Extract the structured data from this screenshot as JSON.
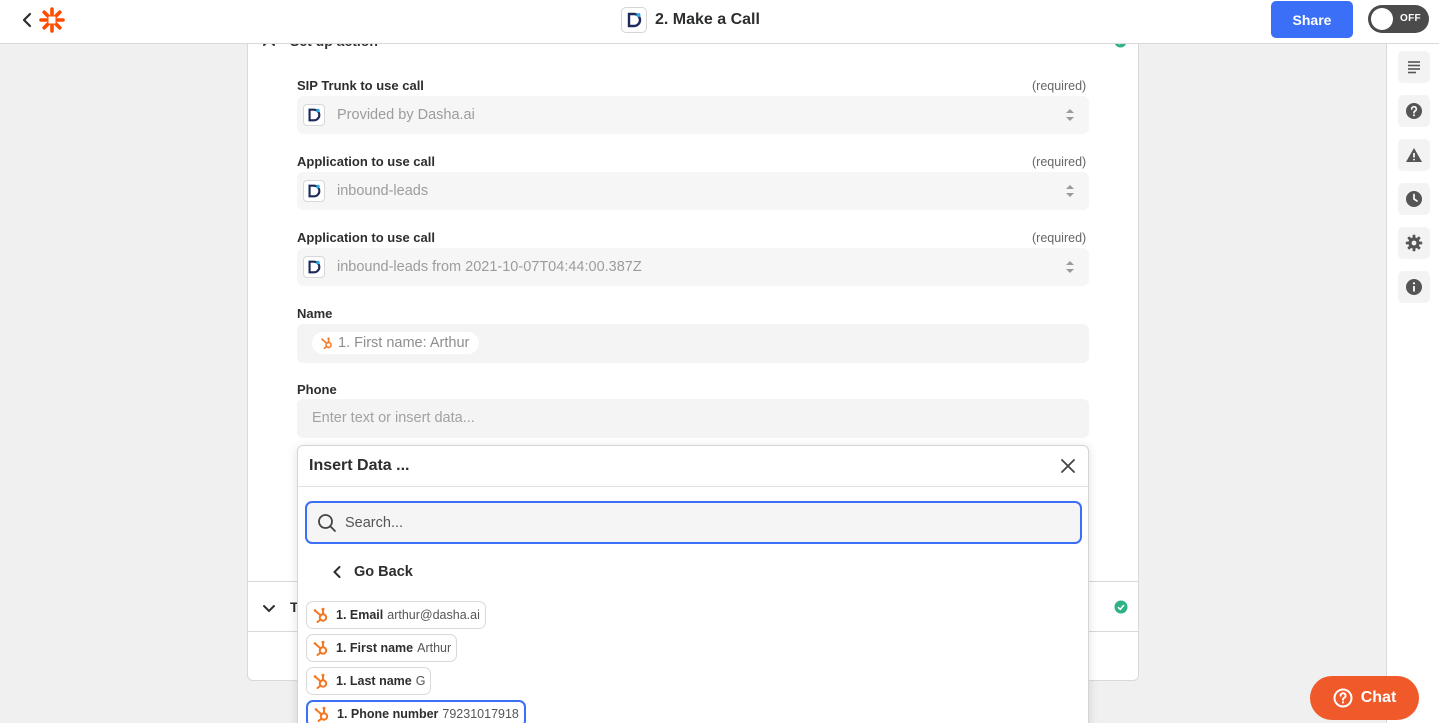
{
  "header": {
    "title": "2. Make a Call",
    "share_label": "Share",
    "toggle_label": "OFF"
  },
  "section": {
    "title": "Set up action",
    "collapsed_letter": "T"
  },
  "fields": [
    {
      "label": "SIP Trunk to use call",
      "required": "(required)",
      "value": "Provided by Dasha.ai"
    },
    {
      "label": "Application to use call",
      "required": "(required)",
      "value": "inbound-leads"
    },
    {
      "label": "Application to use call",
      "required": "(required)",
      "value": "inbound-leads from 2021-10-07T04:44:00.387Z"
    }
  ],
  "name_field": {
    "label": "Name",
    "chip": "1. First name: Arthur"
  },
  "phone_field": {
    "label": "Phone",
    "placeholder": "Enter text or insert data..."
  },
  "insert_data": {
    "title": "Insert Data ...",
    "search_placeholder": "Search...",
    "go_back": "Go Back",
    "items": [
      {
        "key": "1. Email",
        "value": "arthur@dasha.ai"
      },
      {
        "key": "1. First name",
        "value": "Arthur"
      },
      {
        "key": "1. Last name",
        "value": "G"
      },
      {
        "key": "1. Phone number",
        "value": "79231017918"
      }
    ]
  },
  "chat": {
    "label": "Chat"
  },
  "colors": {
    "accent": "#3b6ff7",
    "brand": "#ff4a00",
    "hubspot": "#f57722",
    "chat": "#f0592a",
    "success": "#2fb283"
  },
  "icons": {
    "header": [
      "back-chevron-icon",
      "zapier-logo-icon",
      "dasha-app-icon"
    ],
    "sidebar": [
      "outline-icon",
      "help-icon",
      "warning-icon",
      "clock-icon",
      "gear-icon",
      "info-icon"
    ]
  }
}
